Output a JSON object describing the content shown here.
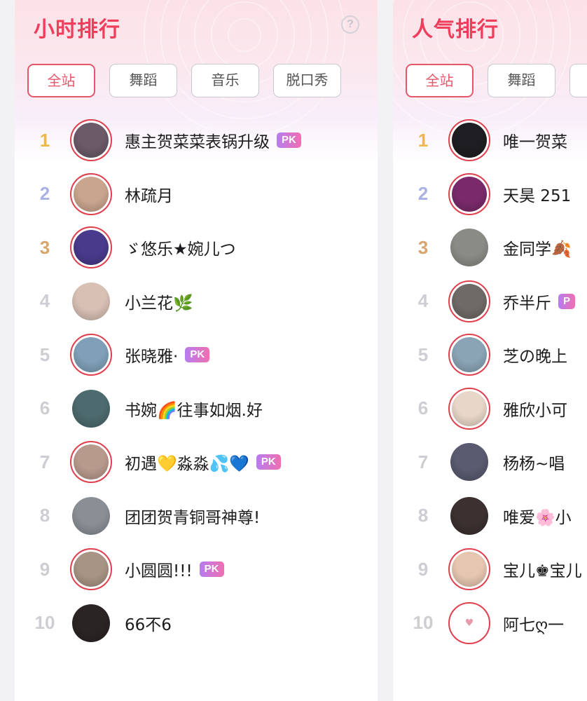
{
  "left_panel": {
    "title": "小时排行",
    "tabs": [
      "全站",
      "舞蹈",
      "音乐",
      "脱口秀"
    ],
    "rows": [
      {
        "rank": "1",
        "name": "惠主贺菜菜表锅升级",
        "pk": "PK",
        "ring": true
      },
      {
        "rank": "2",
        "name": "林疏月",
        "pk": "",
        "ring": true
      },
      {
        "rank": "3",
        "name": "ゞ悠乐★婉儿つ",
        "pk": "",
        "ring": true
      },
      {
        "rank": "4",
        "name": "小兰花🌿",
        "pk": "",
        "ring": false
      },
      {
        "rank": "5",
        "name": "张晓雅·",
        "pk": "PK",
        "ring": true
      },
      {
        "rank": "6",
        "name": "书婉🌈往事如烟.好",
        "pk": "",
        "ring": false
      },
      {
        "rank": "7",
        "name": "初遇💛淼淼💦💙",
        "pk": "PK",
        "ring": true
      },
      {
        "rank": "8",
        "name": "团团贺青铜哥神尊!",
        "pk": "",
        "ring": false
      },
      {
        "rank": "9",
        "name": "小圆圆!!!",
        "pk": "PK",
        "ring": true
      },
      {
        "rank": "10",
        "name": "66不6",
        "pk": "",
        "ring": false
      }
    ]
  },
  "right_panel": {
    "title": "人气排行",
    "tabs": [
      "全站",
      "舞蹈"
    ],
    "rows": [
      {
        "rank": "1",
        "name": "唯一贺菜",
        "pk": "",
        "ring": true
      },
      {
        "rank": "2",
        "name": "天昊 251",
        "pk": "",
        "ring": true
      },
      {
        "rank": "3",
        "name": "金同学🍂",
        "pk": "",
        "ring": false
      },
      {
        "rank": "4",
        "name": "乔半斤",
        "pk": "P",
        "ring": true
      },
      {
        "rank": "5",
        "name": "芝の晚上",
        "pk": "",
        "ring": true
      },
      {
        "rank": "6",
        "name": "雅欣小可",
        "pk": "",
        "ring": true
      },
      {
        "rank": "7",
        "name": "杨杨~唱",
        "pk": "",
        "ring": false
      },
      {
        "rank": "8",
        "name": "唯爱🌸小",
        "pk": "",
        "ring": false
      },
      {
        "rank": "9",
        "name": "宝儿♚宝儿",
        "pk": "",
        "ring": true
      },
      {
        "rank": "10",
        "name": "阿七ღ一",
        "pk": "",
        "ring": true
      }
    ]
  },
  "avatar_colors": [
    "#6b5a68",
    "#c9a58e",
    "#4a3a8c",
    "#d8c0b5",
    "#7fa0b8",
    "#4d6a6e",
    "#b89a8c",
    "#8a8f96",
    "#a89484",
    "#2b2424"
  ],
  "avatar_colors_right": [
    "#1e1e22",
    "#7a2a6a",
    "#8b8b86",
    "#6f6a66",
    "#8aa4b5",
    "#e8d7c8",
    "#5a5a70",
    "#3c3030",
    "#e6c6b0",
    "#ffffff"
  ],
  "accent_color": "#ef3e5c"
}
